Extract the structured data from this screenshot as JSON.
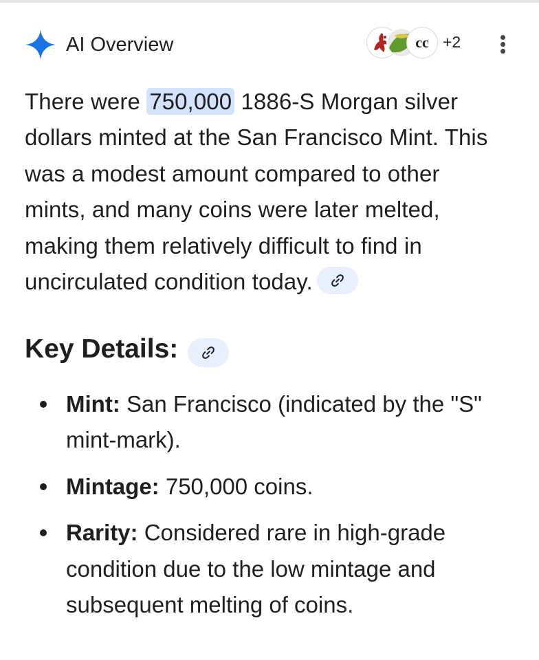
{
  "header": {
    "title": "AI Overview",
    "sources_more": "+2",
    "source_3_text": "cc",
    "spark_color": "#1a73e8",
    "menu_icon": "more-vert-icon"
  },
  "overview": {
    "pre": "There were",
    "highlight": "750,000",
    "post": "1886-S Morgan silver",
    "lines": [
      "dollars minted at the San Francisco Mint. This",
      "was a modest amount compared to other",
      "mints, and many coins were later melted,",
      "making them relatively difficult to find in",
      "uncirculated condition today."
    ]
  },
  "key_details": {
    "heading": "Key Details:",
    "items": [
      {
        "term": "Mint:",
        "lines": [
          " San Francisco (indicated by the \"S\"",
          "mint-mark)."
        ]
      },
      {
        "term": "Mintage:",
        "lines": [
          " 750,000 coins."
        ]
      },
      {
        "term": "Rarity:",
        "lines": [
          " Considered rare in high-grade",
          "condition due to the low mintage and",
          "subsequent melting of coins."
        ]
      }
    ]
  },
  "colors": {
    "highlight_bg": "#d3e3fd",
    "chip_bg": "#e8f0fe",
    "text": "#1f1f1f"
  }
}
